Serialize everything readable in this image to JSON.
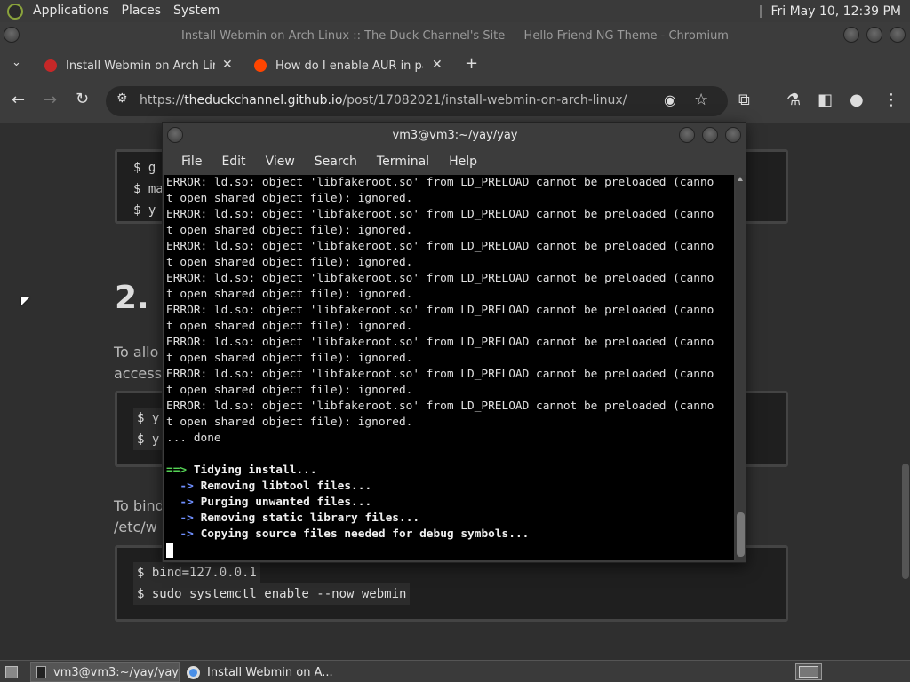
{
  "top_panel": {
    "menus": [
      "Applications",
      "Places",
      "System"
    ],
    "clock": "Fri May 10, 12:39 PM"
  },
  "browser": {
    "window_title": "Install Webmin on Arch Linux :: The Duck Channel's Site — Hello Friend NG Theme - Chromium",
    "tabs": [
      {
        "label": "Install Webmin on Arch Linux",
        "favicon_color": "#c62828"
      },
      {
        "label": "How do I enable AUR in pacma",
        "favicon_color": "#ff4500"
      }
    ],
    "url_scheme": "https://",
    "url_host": "theduckchannel.github.io",
    "url_path": "/post/17082021/install-webmin-on-arch-linux/"
  },
  "page": {
    "code_block_1": [
      "$ g",
      "$ ma",
      "$ y"
    ],
    "heading": "2.",
    "para_1": [
      "To allo",
      "access"
    ],
    "code_block_2": [
      "$ y",
      "$ y"
    ],
    "para_2": [
      "To bind",
      "/etc/w"
    ],
    "code_block_3": [
      "$ bind=127.0.0.1",
      "$ sudo systemctl enable --now webmin"
    ]
  },
  "terminal": {
    "title": "vm3@vm3:~/yay/yay",
    "menu": [
      "File",
      "Edit",
      "View",
      "Search",
      "Terminal",
      "Help"
    ],
    "error_line_a": "ERROR: ld.so: object 'libfakeroot.so' from LD_PRELOAD cannot be preloaded (canno",
    "error_line_b": "t open shared object file): ignored.",
    "last_error_tail": "t open shared object file): ignored.",
    "done_line": "... done",
    "tidying_arrow": "==>",
    "tidying": "Tidying install...",
    "sub_arrow": "->",
    "steps": [
      "Removing libtool files...",
      "Purging unwanted files...",
      "Removing static library files...",
      "Copying source files needed for debug symbols..."
    ]
  },
  "taskbar": {
    "items": [
      {
        "label": "vm3@vm3:~/yay/yay",
        "icon": "terminal-icon"
      },
      {
        "label": "Install Webmin on A...",
        "icon": "chromium-icon"
      }
    ]
  }
}
